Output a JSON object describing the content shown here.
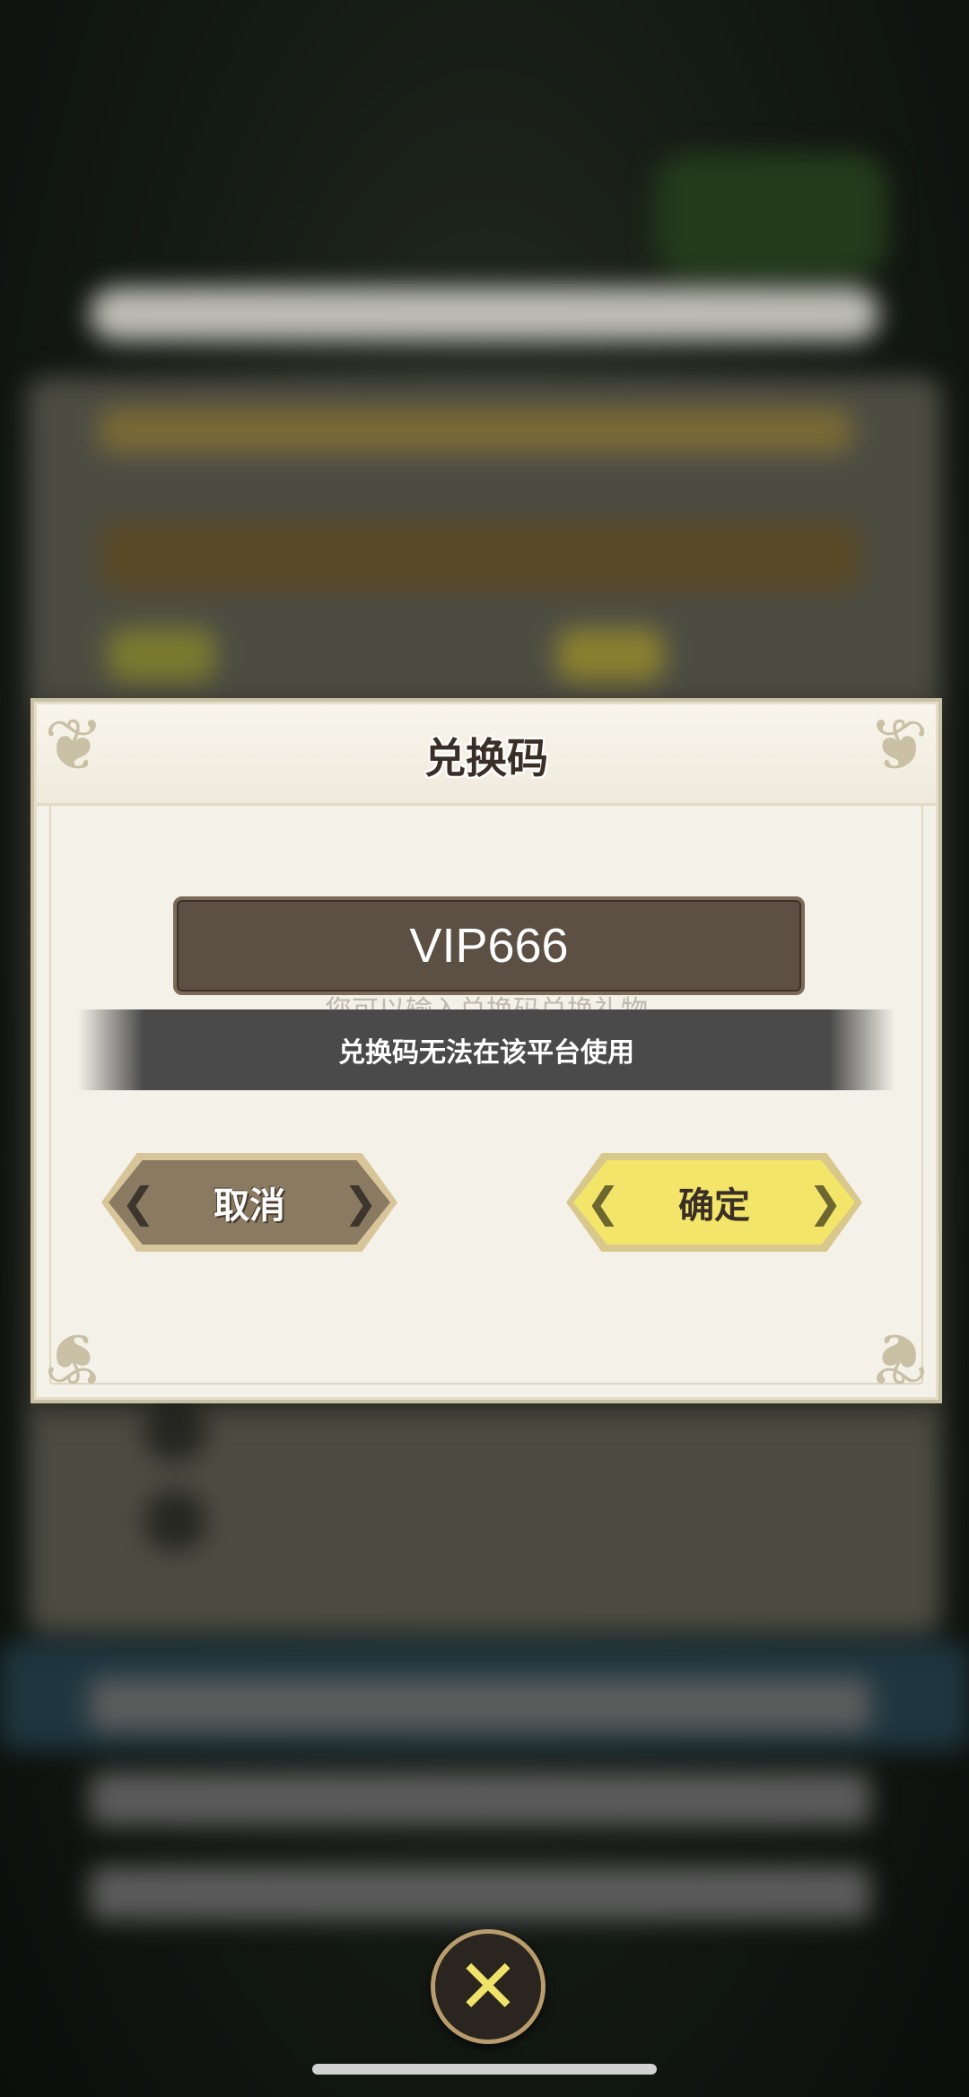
{
  "dialog": {
    "title": "兑换码",
    "code_value": "VIP666",
    "background_hint": "您可以输入兑换码兑换礼物",
    "toast_message": "兑换码无法在该平台使用",
    "cancel_label": "取消",
    "confirm_label": "确定"
  },
  "icons": {
    "close": "close-icon"
  },
  "colors": {
    "confirm_button": "#f3e56a",
    "cancel_button": "#8a7a62",
    "input_background": "#5c4f43",
    "dialog_background": "#f4f1e8"
  }
}
